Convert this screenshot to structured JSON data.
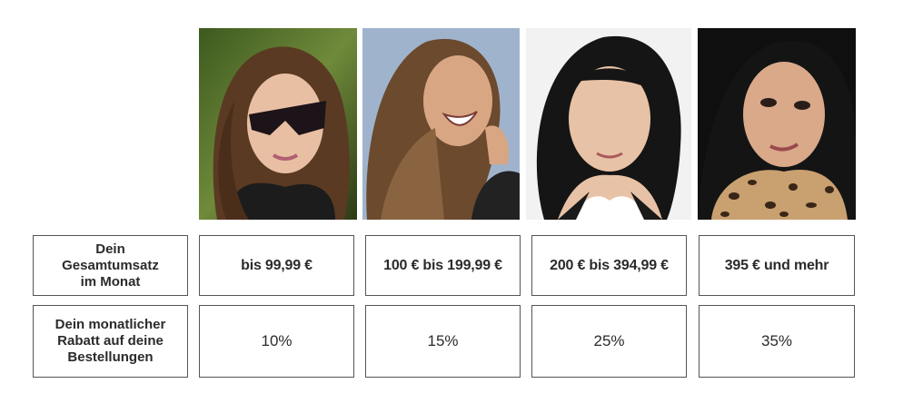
{
  "photos": [
    {
      "subject": "woman-with-sunglasses-photo"
    },
    {
      "subject": "laughing-woman-photo"
    },
    {
      "subject": "smiling-woman-white-background-photo"
    },
    {
      "subject": "woman-with-leopard-scarf-photo"
    }
  ],
  "table": {
    "row_labels": {
      "turnover": "Dein\nGesamtumsatz\nim Monat",
      "discount": "Dein monatlicher\nRabatt auf deine\nBestellungen"
    },
    "tiers": [
      "bis 99,99 €",
      "100 € bis 199,99 €",
      "200 € bis 394,99 €",
      "395 € und mehr"
    ],
    "rates": [
      "10%",
      "15%",
      "25%",
      "35%"
    ]
  }
}
